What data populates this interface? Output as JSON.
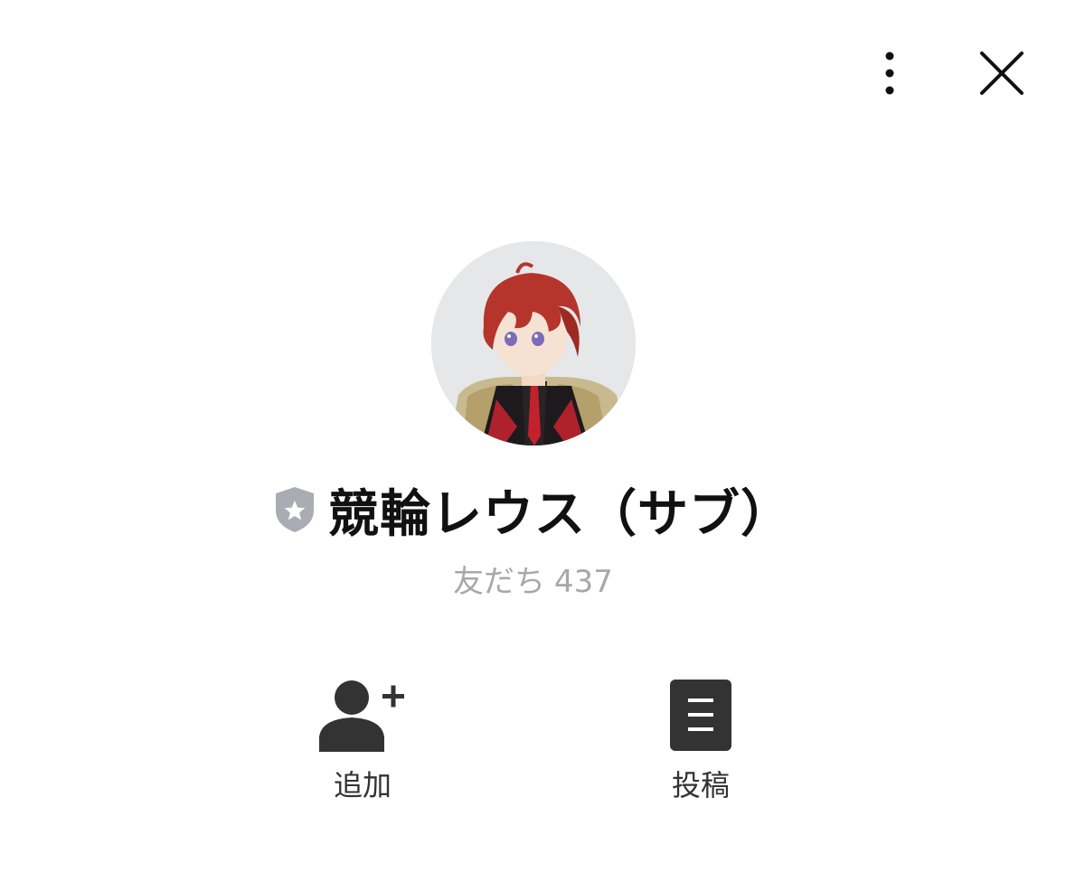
{
  "header": {
    "more_icon": "kebab-vertical-icon",
    "close_icon": "close-x-icon"
  },
  "profile": {
    "avatar_alt": "profile-avatar",
    "badge_icon": "verified-shield-star-icon",
    "name": "競輪レウス（サブ）",
    "friends_label": "友だち",
    "friends_count": "437"
  },
  "actions": {
    "add": {
      "label": "追加",
      "icon": "add-friend-icon"
    },
    "post": {
      "label": "投稿",
      "icon": "posts-icon"
    }
  },
  "colors": {
    "text_primary": "#111111",
    "text_secondary": "#a8a8a8",
    "icon_dark": "#333333",
    "badge_gray": "#a9adb3",
    "avatar_bg": "#e6e7e9"
  }
}
